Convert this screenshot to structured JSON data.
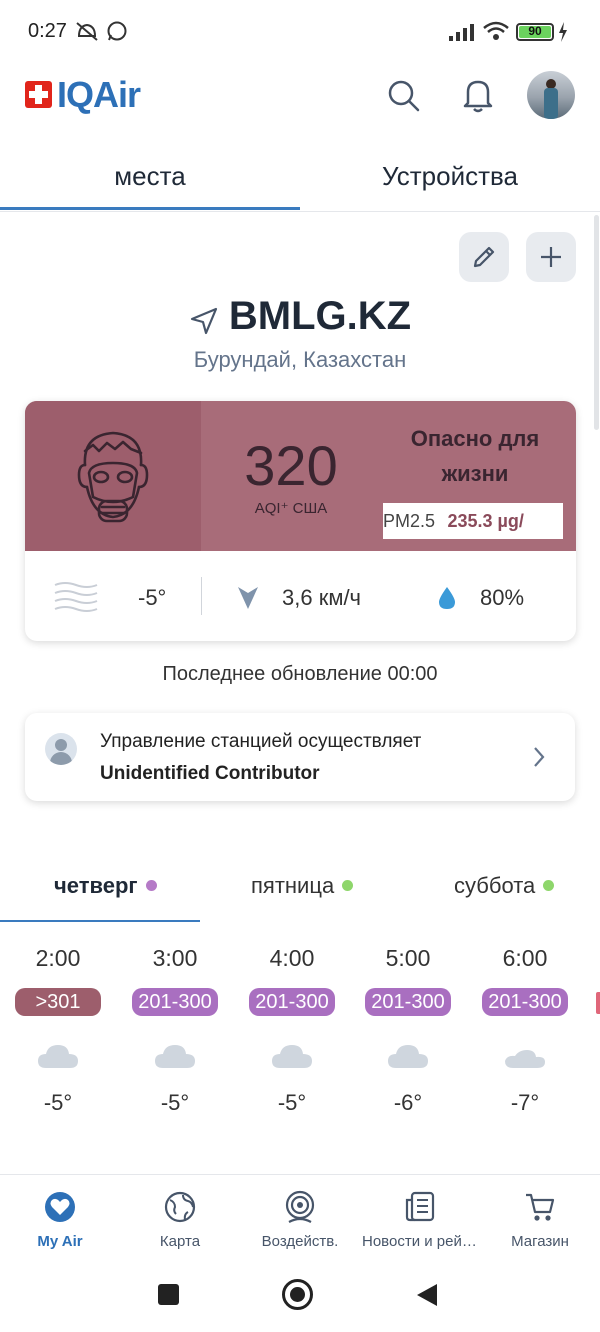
{
  "status_bar": {
    "time": "0:27",
    "battery": "90"
  },
  "header": {
    "brand": "IQAir"
  },
  "tabs": [
    {
      "label": "места",
      "active": true
    },
    {
      "label": "Устройства",
      "active": false
    }
  ],
  "location": {
    "name": "BMLG.KZ",
    "region": "Бурундай, Казахстан"
  },
  "aqi": {
    "value": "320",
    "unit": "AQI⁺ США",
    "status": "Опасно для жизни",
    "pollutant": "PM2.5",
    "concentration": "235.3 µg/"
  },
  "weather": {
    "temperature": "-5°",
    "wind": "3,6 км/ч",
    "humidity": "80%"
  },
  "last_update": "Последнее обновление 00:00",
  "contributor": {
    "line1": "Управление станцией осуществляет",
    "line2": "Unidentified Contributor"
  },
  "forecast_days": [
    {
      "label": "четверг",
      "dot_color": "#b57ac7",
      "active": true
    },
    {
      "label": "пятница",
      "dot_color": "#8ed66b",
      "active": false
    },
    {
      "label": "суббота",
      "dot_color": "#8ed66b",
      "active": false
    }
  ],
  "hourly": [
    {
      "time": "2:00",
      "aqi_range": ">301",
      "color": "#9d5e6c",
      "temp": "-5°"
    },
    {
      "time": "3:00",
      "aqi_range": "201-300",
      "color": "#a96fc0",
      "temp": "-5°"
    },
    {
      "time": "4:00",
      "aqi_range": "201-300",
      "color": "#a96fc0",
      "temp": "-5°"
    },
    {
      "time": "5:00",
      "aqi_range": "201-300",
      "color": "#a96fc0",
      "temp": "-6°"
    },
    {
      "time": "6:00",
      "aqi_range": "201-300",
      "color": "#a96fc0",
      "temp": "-7°"
    }
  ],
  "bottom_nav": [
    {
      "label": "My Air",
      "icon": "heart-icon",
      "active": true
    },
    {
      "label": "Карта",
      "icon": "globe-icon",
      "active": false
    },
    {
      "label": "Воздейств.",
      "icon": "exposure-icon",
      "active": false
    },
    {
      "label": "Новости и рейтинги",
      "icon": "news-icon",
      "active": false
    },
    {
      "label": "Магазин",
      "icon": "cart-icon",
      "active": false
    }
  ]
}
